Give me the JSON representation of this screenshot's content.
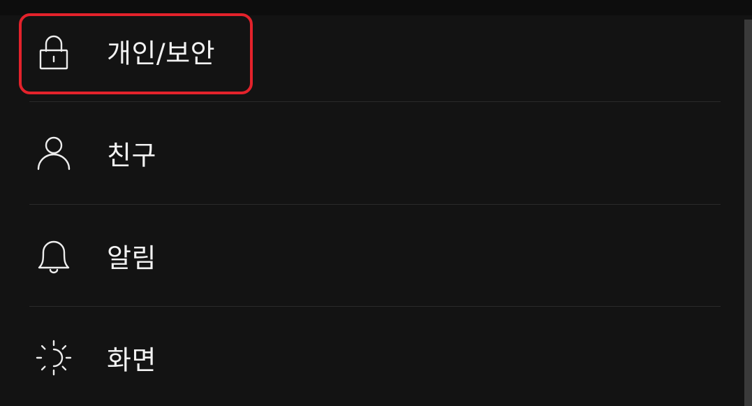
{
  "settings_menu": {
    "items": [
      {
        "label": "개인/보안",
        "icon": "lock-icon"
      },
      {
        "label": "친구",
        "icon": "person-icon"
      },
      {
        "label": "알림",
        "icon": "bell-icon"
      },
      {
        "label": "화면",
        "icon": "brightness-icon"
      }
    ]
  },
  "highlight": {
    "color": "#e3222b",
    "target": "개인/보안"
  }
}
